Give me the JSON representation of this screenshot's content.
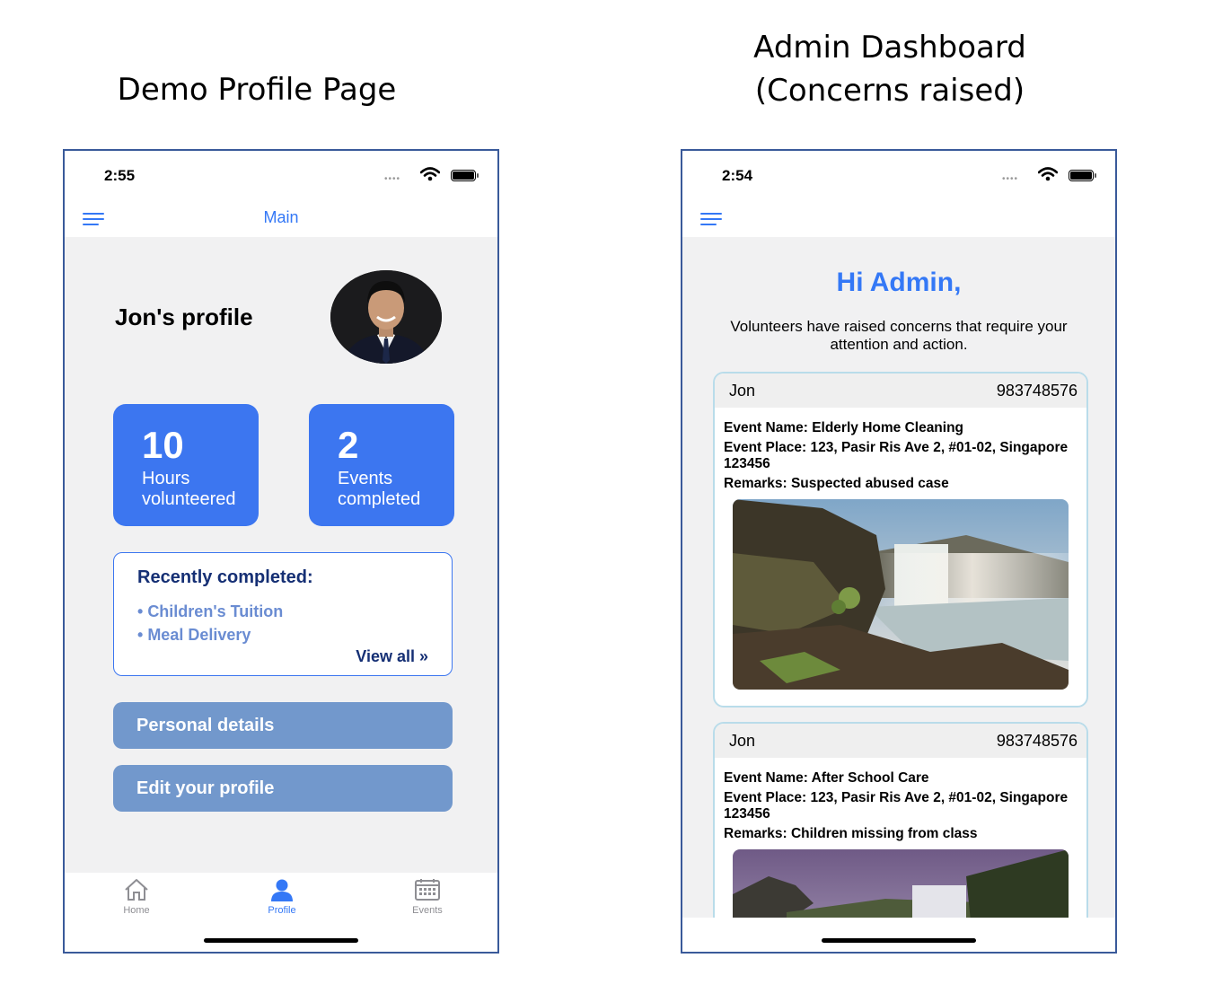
{
  "captions": {
    "left": "Demo Profile Page",
    "right_line1": "Admin Dashboard",
    "right_line2": "(Concerns raised)"
  },
  "profile_screen": {
    "status_time": "2:55",
    "nav_title": "Main",
    "profile_title": "Jon's profile",
    "stats": [
      {
        "value": "10",
        "label": "Hours volunteered"
      },
      {
        "value": "2",
        "label": "Events completed"
      }
    ],
    "recent": {
      "title": "Recently completed:",
      "items": [
        "Children's Tuition",
        "Meal Delivery"
      ],
      "view_all": "View all »"
    },
    "buttons": {
      "personal_details": "Personal details",
      "edit_profile": "Edit your profile"
    },
    "tabs": [
      {
        "label": "Home",
        "icon": "home-icon"
      },
      {
        "label": "Profile",
        "icon": "person-icon"
      },
      {
        "label": "Events",
        "icon": "calendar-icon"
      }
    ],
    "colors": {
      "accent": "#3478f6",
      "stat_bg": "#3c76f0",
      "button_bg": "#7298cc",
      "dark_navy": "#152f74"
    }
  },
  "admin_screen": {
    "status_time": "2:54",
    "greeting": "Hi Admin,",
    "intro": "Volunteers have raised concerns that require your attention and action.",
    "concerns": [
      {
        "name": "Jon",
        "phone": "983748576",
        "event_name": "Event Name: Elderly Home Cleaning",
        "event_place": "Event Place: 123, Pasir Ris Ave 2, #01-02, Singapore 123456",
        "remarks": "Remarks: Suspected abused case"
      },
      {
        "name": "Jon",
        "phone": "983748576",
        "event_name": "Event Name: After School Care",
        "event_place": "Event Place: 123, Pasir Ris Ave 2, #01-02, Singapore 123456",
        "remarks": "Remarks: Children missing from class"
      }
    ]
  }
}
